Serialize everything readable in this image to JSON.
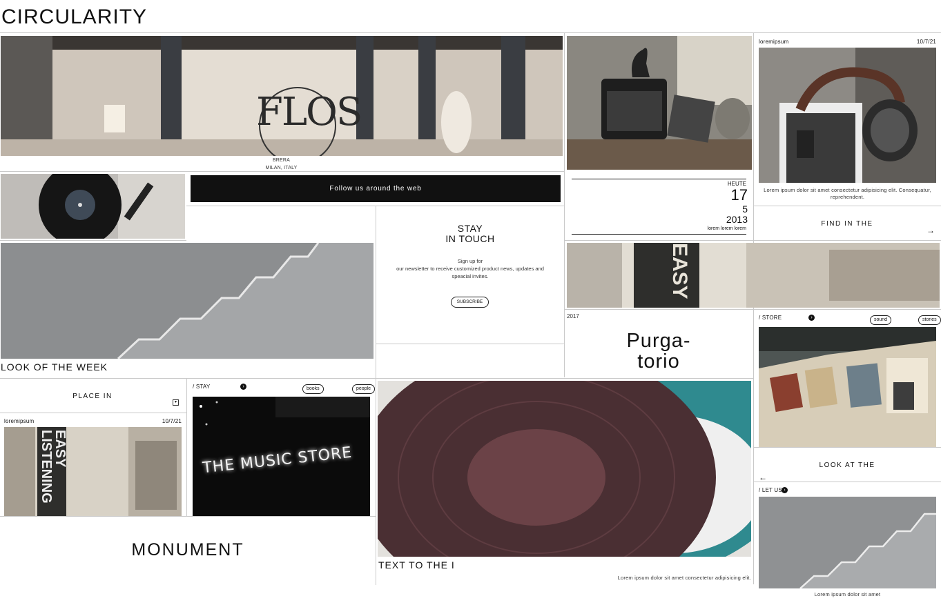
{
  "site": {
    "title": "CIRCULARITY"
  },
  "hero": {
    "caption_line1": "BRERA",
    "caption_line2": "MILAN, ITALY"
  },
  "follow": {
    "label": "Follow us around the web"
  },
  "newsletter": {
    "title_line1": "STAY",
    "title_line2": "IN TOUCH",
    "text_line1": "Sign up for",
    "text_line2": "our newsletter to receive customized product news, updates and",
    "text_line3": "speacial invites.",
    "button": "SUBSCRIBE"
  },
  "headphones_card": {
    "tag": "loremipsum",
    "date": "10/7/21",
    "text_line1": "Lorem ipsum dolor sit amet consectetur adipisicing elit. Consequatur,",
    "text_line2": "reprehendent."
  },
  "calendar": {
    "label": "HEUTE",
    "day": "17",
    "month": "5",
    "year": "2013",
    "footer": "lorem lorem lorem"
  },
  "find_in": {
    "label": "FIND IN THE",
    "arrow": "arrow-right-icon"
  },
  "look_week": {
    "label": "LOOK OF THE WEEK"
  },
  "purgatorio": {
    "year": "2017",
    "line1": "Purga-",
    "line2": "torio"
  },
  "store_card": {
    "tag": "/ STORE",
    "pill1": "sound",
    "pill2": "stories"
  },
  "place_in": {
    "label": "PLACE IN"
  },
  "easy_card": {
    "tag": "loremipsum",
    "date": "10/7/21"
  },
  "music_card": {
    "tag": "/ STAY",
    "pill1": "books",
    "pill2": "people"
  },
  "monument": {
    "label": "MONUMENT"
  },
  "vinyl_feature": {
    "label": "TEXT TO THE I",
    "text": "Lorem ipsum dolor sit amet consectetur adipisicing elit."
  },
  "look_at": {
    "label": "LOOK AT THE",
    "arrow": "arrow-left-icon"
  },
  "let_us_card": {
    "tag": "/ LET US",
    "caption": "Lorem ipsum dolor sit amet"
  },
  "neon_sign": "THE MUSIC STORE",
  "easy_sign_line1": "EASY",
  "easy_sign_line2": "LISTENING"
}
